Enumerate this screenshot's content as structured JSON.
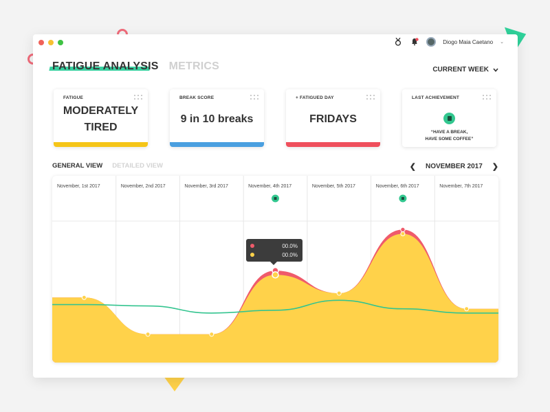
{
  "colors": {
    "accent_green": "#3ad0a0",
    "yellow": "#ffd24a",
    "red": "#ef5b6b",
    "blue": "#4a9fe0",
    "teal_line": "#33c48f",
    "tooltip_bg": "#3c3c3c"
  },
  "window": {
    "dots": [
      "#f0625a",
      "#f7c032",
      "#3fc243"
    ]
  },
  "topbar": {
    "medal_icon": "medal-icon",
    "bell_icon": "bell-icon",
    "username": "Diogo Maia Caetano",
    "menu_icon": "chevron-down-icon"
  },
  "tabs": {
    "active": "FATIGUE ANALYSIS",
    "inactive": "METRICS"
  },
  "week_select": {
    "label": "CURRENT WEEK"
  },
  "cards": [
    {
      "label": "FATIGUE",
      "value_line1": "MODERATELY",
      "value_line2": "TIRED",
      "bar_color": "#f5c518"
    },
    {
      "label": "BREAK SCORE",
      "value": "9 in 10 breaks",
      "bar_color": "#4a9fe0"
    },
    {
      "label": "+ FATIGUED DAY",
      "value": "FRIDAYS",
      "bar_color": "#ef4f5c"
    },
    {
      "label": "LAST ACHIEVEMENT",
      "icon": "coffee-icon",
      "quote_line1": "“HAVE A BREAK,",
      "quote_line2": "HAVE SOME COFFEE”",
      "bar_color": "#ffffff"
    }
  ],
  "view_tabs": {
    "active": "GENERAL VIEW",
    "inactive": "DETAILED VIEW"
  },
  "month_nav": {
    "label": "NOVEMBER 2017"
  },
  "tooltip": {
    "red_value": "00.0%",
    "yellow_value": "00.0%"
  },
  "chart_data": {
    "type": "area",
    "x": [
      "November, 1st 2017",
      "November, 2nd 2017",
      "November, 3rd 2017",
      "November, 4th 2017",
      "November, 5th 2017",
      "November, 6th 2017",
      "November, 7th 2017"
    ],
    "achievement_days": [
      "November, 4th 2017",
      "November, 6th 2017"
    ],
    "series": [
      {
        "color": "#ef5b6b",
        "values": [
          0.46,
          0.2,
          0.2,
          0.65,
          0.49,
          0.94,
          0.38
        ]
      },
      {
        "color": "#ffd24a",
        "values": [
          0.46,
          0.2,
          0.2,
          0.62,
          0.49,
          0.91,
          0.38
        ]
      },
      {
        "color": "#33c48f",
        "values": [
          0.41,
          0.4,
          0.35,
          0.37,
          0.44,
          0.38,
          0.35
        ]
      }
    ],
    "ylim": [
      0,
      1
    ],
    "grid": true
  }
}
